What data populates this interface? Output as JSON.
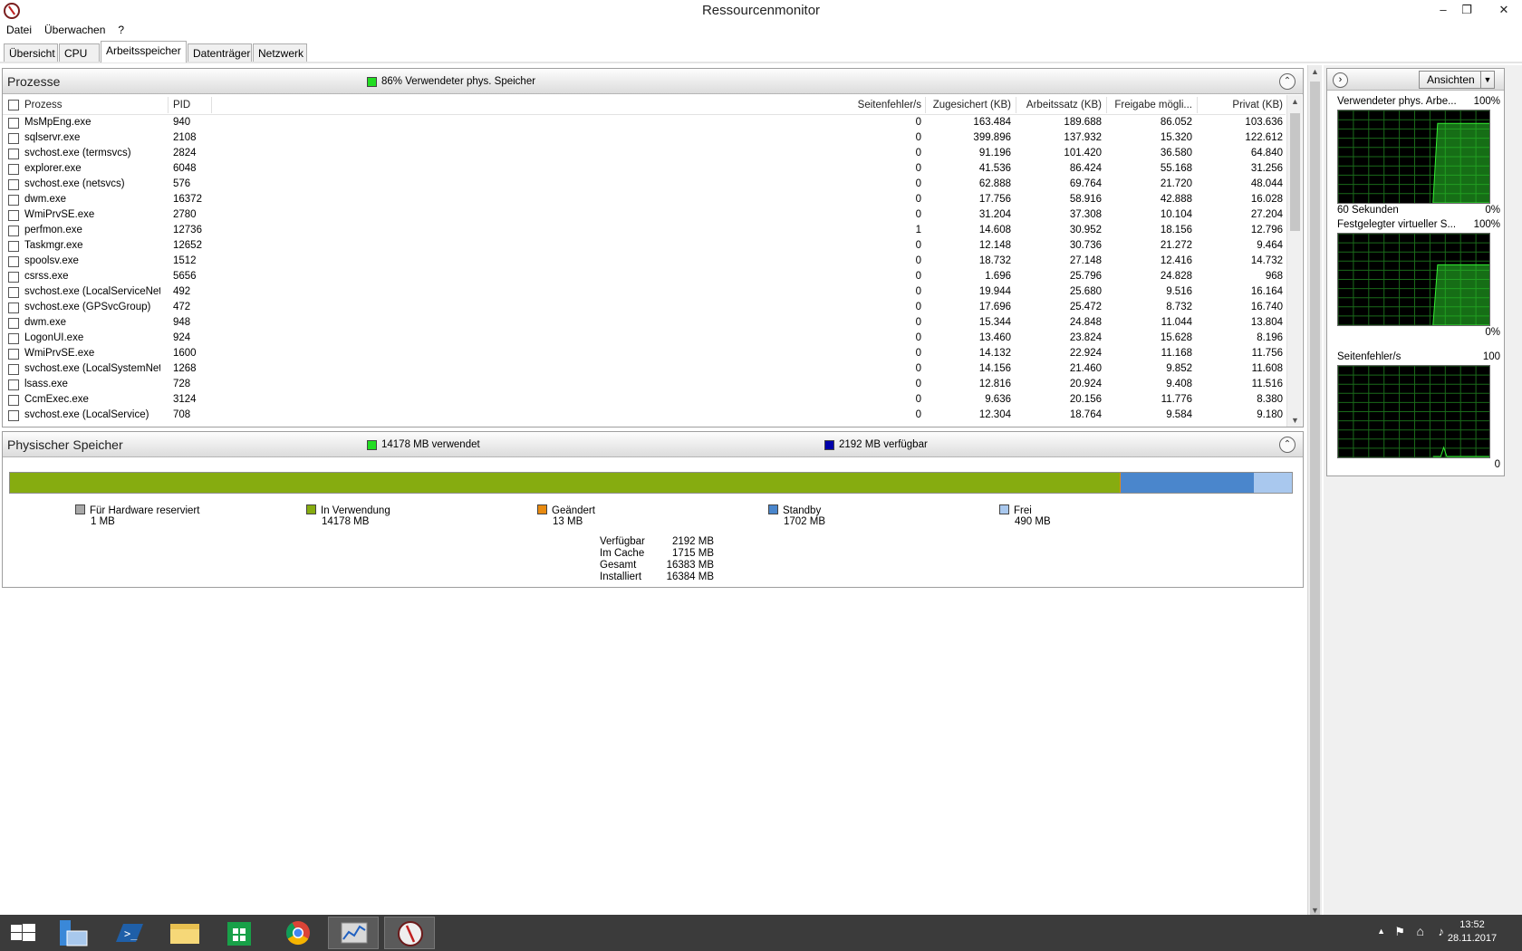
{
  "window": {
    "title": "Ressourcenmonitor",
    "minimize": "–",
    "restore": "❐",
    "close": "✕"
  },
  "menu": [
    "Datei",
    "Überwachen",
    "?"
  ],
  "tabs": [
    "Übersicht",
    "CPU",
    "Arbeitsspeicher",
    "Datenträger",
    "Netzwerk"
  ],
  "active_tab": "Arbeitsspeicher",
  "processes": {
    "title": "Prozesse",
    "legend_text": "86% Verwendeter phys. Speicher",
    "legend_color": "#22dd22",
    "columns": [
      "Prozess",
      "PID",
      "Seitenfehler/s",
      "Zugesichert (KB)",
      "Arbeitssatz (KB)",
      "Freigabe mögli...",
      "Privat (KB)"
    ],
    "rows": [
      [
        "MsMpEng.exe",
        "940",
        "0",
        "163.484",
        "189.688",
        "86.052",
        "103.636"
      ],
      [
        "sqlservr.exe",
        "2108",
        "0",
        "399.896",
        "137.932",
        "15.320",
        "122.612"
      ],
      [
        "svchost.exe (termsvcs)",
        "2824",
        "0",
        "91.196",
        "101.420",
        "36.580",
        "64.840"
      ],
      [
        "explorer.exe",
        "6048",
        "0",
        "41.536",
        "86.424",
        "55.168",
        "31.256"
      ],
      [
        "svchost.exe (netsvcs)",
        "576",
        "0",
        "62.888",
        "69.764",
        "21.720",
        "48.044"
      ],
      [
        "dwm.exe",
        "16372",
        "0",
        "17.756",
        "58.916",
        "42.888",
        "16.028"
      ],
      [
        "WmiPrvSE.exe",
        "2780",
        "0",
        "31.204",
        "37.308",
        "10.104",
        "27.204"
      ],
      [
        "perfmon.exe",
        "12736",
        "1",
        "14.608",
        "30.952",
        "18.156",
        "12.796"
      ],
      [
        "Taskmgr.exe",
        "12652",
        "0",
        "12.148",
        "30.736",
        "21.272",
        "9.464"
      ],
      [
        "spoolsv.exe",
        "1512",
        "0",
        "18.732",
        "27.148",
        "12.416",
        "14.732"
      ],
      [
        "csrss.exe",
        "5656",
        "0",
        "1.696",
        "25.796",
        "24.828",
        "968"
      ],
      [
        "svchost.exe (LocalServiceNet...",
        "492",
        "0",
        "19.944",
        "25.680",
        "9.516",
        "16.164"
      ],
      [
        "svchost.exe (GPSvcGroup)",
        "472",
        "0",
        "17.696",
        "25.472",
        "8.732",
        "16.740"
      ],
      [
        "dwm.exe",
        "948",
        "0",
        "15.344",
        "24.848",
        "11.044",
        "13.804"
      ],
      [
        "LogonUI.exe",
        "924",
        "0",
        "13.460",
        "23.824",
        "15.628",
        "8.196"
      ],
      [
        "WmiPrvSE.exe",
        "1600",
        "0",
        "14.132",
        "22.924",
        "11.168",
        "11.756"
      ],
      [
        "svchost.exe (LocalSystemNet...",
        "1268",
        "0",
        "14.156",
        "21.460",
        "9.852",
        "11.608"
      ],
      [
        "lsass.exe",
        "728",
        "0",
        "12.816",
        "20.924",
        "9.408",
        "11.516"
      ],
      [
        "CcmExec.exe",
        "3124",
        "0",
        "9.636",
        "20.156",
        "11.776",
        "8.380"
      ],
      [
        "svchost.exe (LocalService)",
        "708",
        "0",
        "12.304",
        "18.764",
        "9.584",
        "9.180"
      ]
    ]
  },
  "physical": {
    "title": "Physischer Speicher",
    "legend_used": "14178 MB verwendet",
    "legend_used_color": "#22dd22",
    "legend_avail": "2192 MB verfügbar",
    "legend_avail_color": "#0000aa",
    "bar": [
      {
        "label": "Für Hardware reserviert",
        "value": "1 MB",
        "mb": 1,
        "color": "#a8a8a8"
      },
      {
        "label": "In Verwendung",
        "value": "14178 MB",
        "mb": 14178,
        "color": "#86ac10"
      },
      {
        "label": "Geändert",
        "value": "13 MB",
        "mb": 13,
        "color": "#e88a10"
      },
      {
        "label": "Standby",
        "value": "1702 MB",
        "mb": 1702,
        "color": "#4a86cc"
      },
      {
        "label": "Frei",
        "value": "490 MB",
        "mb": 490,
        "color": "#a9c8ee"
      }
    ],
    "stats": [
      {
        "label": "Verfügbar",
        "value": "2192 MB"
      },
      {
        "label": "Im Cache",
        "value": "1715 MB"
      },
      {
        "label": "Gesamt",
        "value": "16383 MB"
      },
      {
        "label": "Installiert",
        "value": "16384 MB"
      }
    ]
  },
  "right": {
    "views_button": "Ansichten",
    "graphs": [
      {
        "title": "Verwendeter phys. Arbe...",
        "max": "100%",
        "footer_left": "60 Sekunden",
        "footer_right": "0%",
        "level": 0.86
      },
      {
        "title": "Festgelegter virtueller S...",
        "max": "100%",
        "footer_left": "",
        "footer_right": "0%",
        "level": 0.66
      },
      {
        "title": "Seitenfehler/s",
        "max": "100",
        "footer_left": "",
        "footer_right": "0",
        "level": 0.0
      }
    ]
  },
  "taskbar": {
    "apps": [
      "windows-start-icon",
      "server-manager-icon",
      "powershell-icon",
      "file-explorer-icon",
      "store-icon",
      "chrome-icon",
      "perfmon-icon",
      "resource-monitor-icon"
    ],
    "clock_time": "13:52",
    "clock_date": "28.11.2017"
  }
}
